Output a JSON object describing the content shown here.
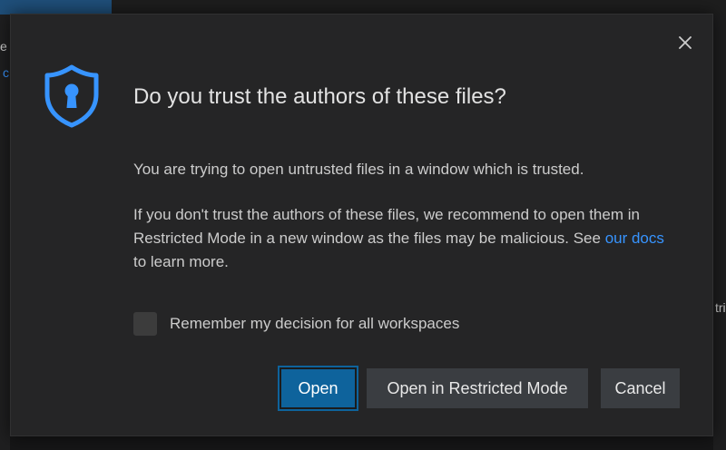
{
  "background": {
    "left_fragment_1": "e",
    "left_fragment_2": "c",
    "right_fragment": "tri"
  },
  "dialog": {
    "close_icon": "close-icon",
    "icon": "shield-keyhole-icon",
    "title": "Do you trust the authors of these files?",
    "message_1": "You are trying to open untrusted files in a window which is trusted.",
    "message_2_pre": "If you don't trust the authors of these files, we recommend to open them in Restricted Mode in a new window as the files may be malicious. See ",
    "message_2_link": "our docs",
    "message_2_post": " to learn more.",
    "checkbox_label": "Remember my decision for all workspaces",
    "checkbox_checked": false,
    "buttons": {
      "open": "Open",
      "restricted": "Open in Restricted Mode",
      "cancel": "Cancel"
    }
  },
  "colors": {
    "accent": "#0e639c",
    "link": "#3794ff",
    "shield": "#3794ff",
    "dialog_bg": "#252526"
  }
}
